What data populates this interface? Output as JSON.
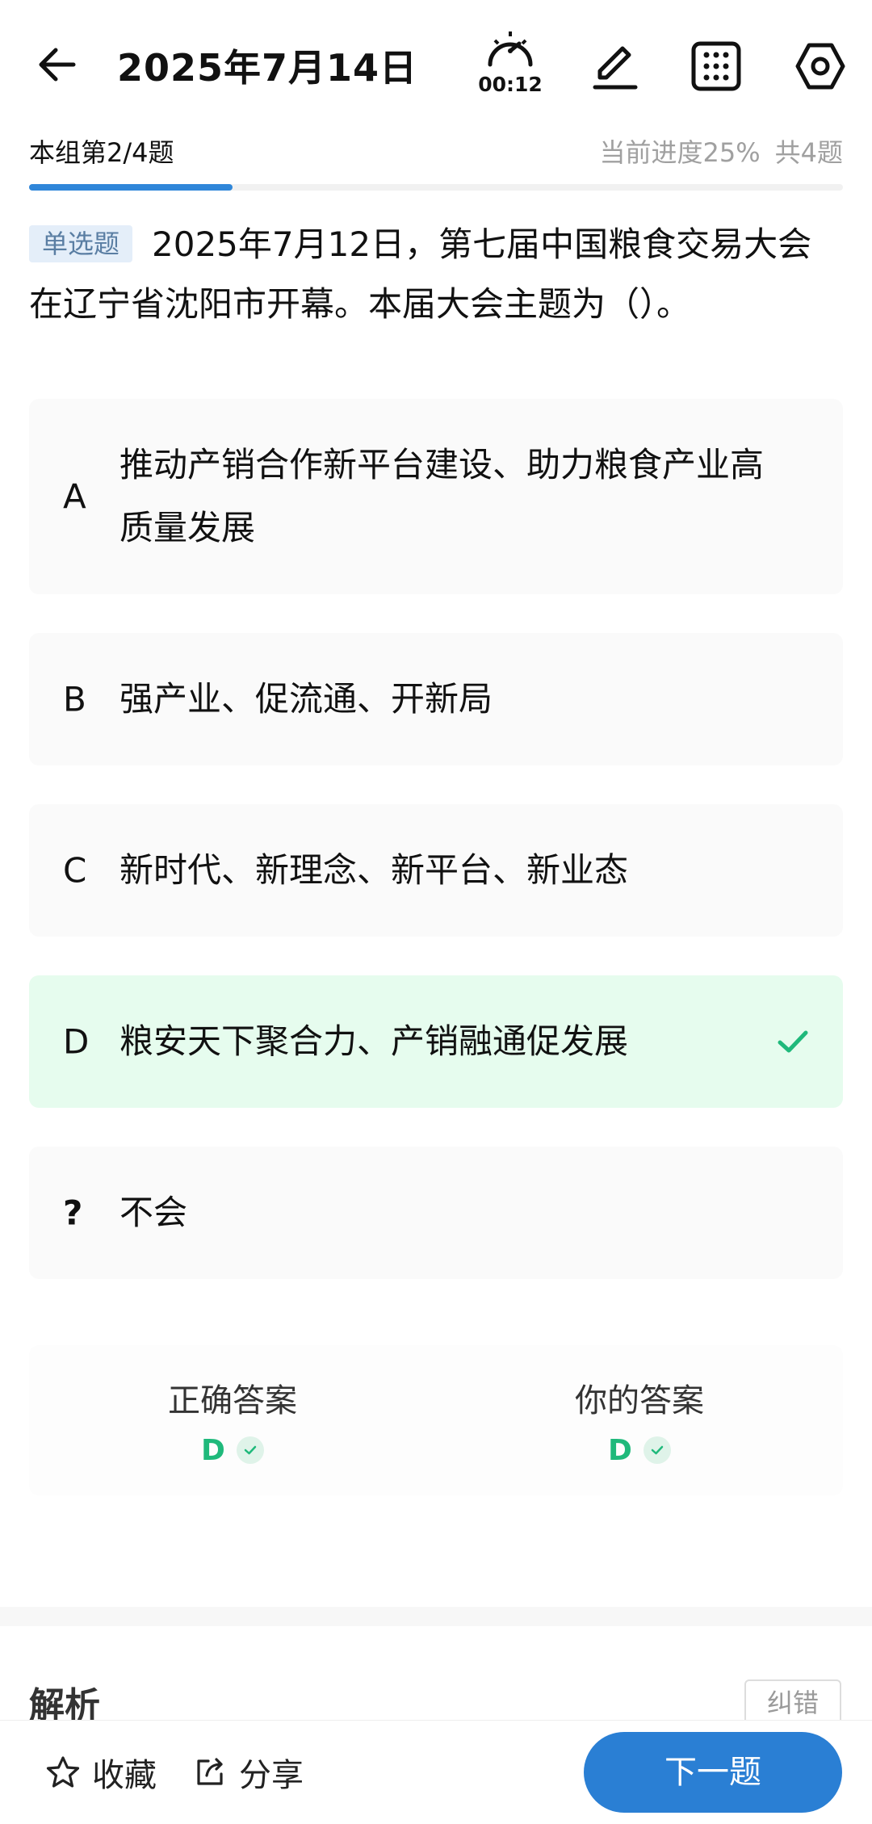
{
  "header": {
    "title": "2025年7月14日",
    "timer": "00:12",
    "icons": [
      "back-arrow-icon",
      "stopwatch-icon",
      "pencil-icon",
      "grid-icon",
      "settings-icon"
    ]
  },
  "progress": {
    "group_label": "本组第2/4题",
    "current_label": "当前进度25%",
    "total_label": "共4题",
    "fraction": 0.25
  },
  "question": {
    "type": "单选题",
    "text": "2025年7月12日，第七届中国粮食交易大会在辽宁省沈阳市开幕。本届大会主题为（）。"
  },
  "options": [
    {
      "letter": "A",
      "text": "推动产销合作新平台建设、助力粮食产业高质量发展",
      "selected": false
    },
    {
      "letter": "B",
      "text": "强产业、促流通、开新局",
      "selected": false
    },
    {
      "letter": "C",
      "text": "新时代、新理念、新平台、新业态",
      "selected": false
    },
    {
      "letter": "D",
      "text": "粮安天下聚合力、产销融通促发展",
      "selected": true
    },
    {
      "letter": "?",
      "text": "不会",
      "selected": false
    }
  ],
  "answers": {
    "correct_label": "正确答案",
    "correct_value": "D",
    "yours_label": "你的答案",
    "yours_value": "D"
  },
  "analysis": {
    "title": "解析",
    "report_label": "纠错"
  },
  "bottom": {
    "favorite_label": "收藏",
    "share_label": "分享",
    "next_label": "下一题"
  },
  "colors": {
    "accent": "#2a7fd4",
    "correct_bg": "#e6fcee",
    "correct_text": "#1fb97b",
    "option_bg": "#fafafa"
  }
}
